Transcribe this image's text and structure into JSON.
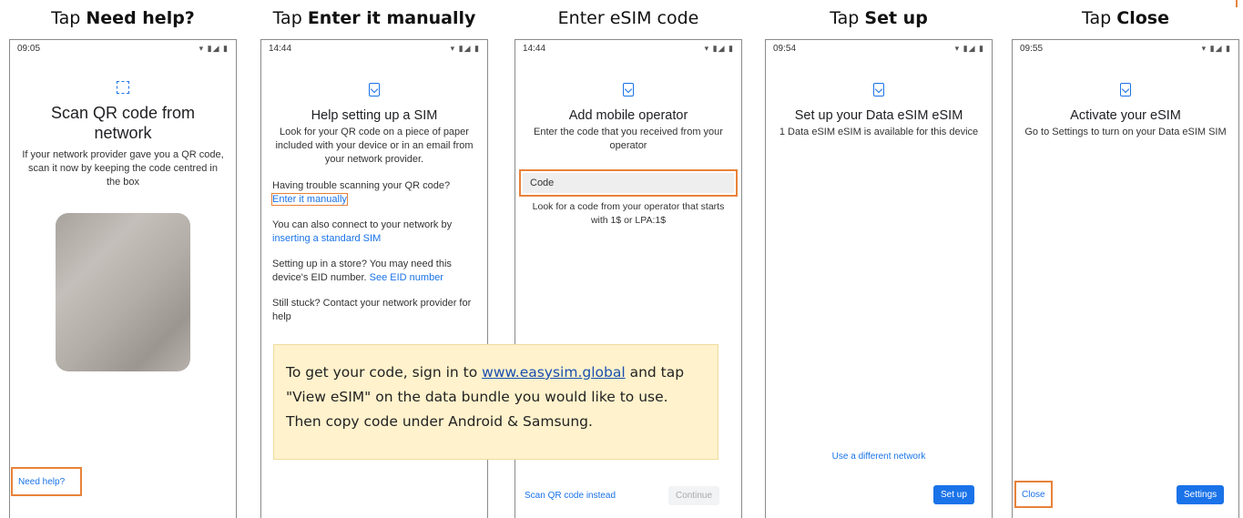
{
  "captions": {
    "c1": {
      "prefix": "Tap ",
      "bold": "Need help?"
    },
    "c2": {
      "prefix": "Tap ",
      "bold": "Enter it manually"
    },
    "c3": {
      "text": "Enter eSIM code"
    },
    "c4": {
      "prefix": "Tap ",
      "bold": "Set up"
    },
    "c5": {
      "prefix": "Tap ",
      "bold": "Close"
    }
  },
  "screen1": {
    "time": "09:05",
    "status_icons": "▾ ▮◢ ▮",
    "title": "Scan QR code from network",
    "subtitle": "If your network provider gave you a QR code, scan it now by keeping the code centred in the box",
    "need_help": "Need help?"
  },
  "screen2": {
    "time": "14:44",
    "title": "Help setting up a SIM",
    "subtitle": "Look for your QR code on a piece of paper included with your device or in an email from your network provider.",
    "trouble": "Having trouble scanning your QR code?",
    "enter_manually": "Enter it manually",
    "connect_text": "You can also connect to your network by",
    "connect_link": "inserting a standard SIM",
    "store_text": "Setting up in a store? You may need this device's EID number.",
    "store_link": "See EID number",
    "stuck": "Still stuck? Contact your network provider for help"
  },
  "screen3": {
    "time": "14:44",
    "title": "Add mobile operator",
    "subtitle": "Enter the code that you received from your operator",
    "code_placeholder": "Code",
    "hint": "Look for a code from your operator that starts with 1$ or LPA:1$",
    "scan_instead": "Scan QR code instead",
    "continue": "Continue"
  },
  "screen4": {
    "time": "09:54",
    "title": "Set up your Data eSIM eSIM",
    "subtitle": "1 Data eSIM eSIM is available for this device",
    "different_network": "Use a different network",
    "setup": "Set up"
  },
  "screen5": {
    "time": "09:55",
    "title": "Activate your eSIM",
    "subtitle": "Go to Settings to turn on your Data eSIM SIM",
    "close": "Close",
    "settings": "Settings"
  },
  "note": {
    "before": "To get your code, sign in to ",
    "url": "www.easysim.global",
    "after": " and tap \"View eSIM\" on the data bundle you would like to use. Then copy code under Android & Samsung."
  },
  "colors": {
    "accent": "#e8823a",
    "link": "#1a73e8",
    "note_bg": "#fff2cc"
  }
}
